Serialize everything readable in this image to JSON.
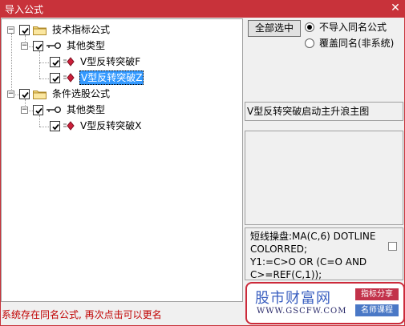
{
  "window": {
    "title": "导入公式",
    "close_glyph": "✕"
  },
  "tree": {
    "expander_open": "−",
    "nodes": [
      {
        "label": "技术指标公式"
      },
      {
        "label": "其他类型"
      },
      {
        "label": "V型反转突破F"
      },
      {
        "label": "V型反转突破Z",
        "selected": true
      },
      {
        "label": "条件选股公式"
      },
      {
        "label": "其他类型"
      },
      {
        "label": "V型反转突破X"
      }
    ]
  },
  "right": {
    "select_all_label": "全部选中",
    "radios": [
      {
        "label": "不导入同名公式",
        "checked": true
      },
      {
        "label": "覆盖同名(非系统)",
        "checked": false
      }
    ],
    "description": "V型反转突破启动主升浪主图",
    "code_lines": [
      "短线操盘:MA(C,6) DOTLINE",
      "COLORRED;",
      "Y1:=C>O OR (C=O AND",
      "C>=REF(C,1));"
    ]
  },
  "watermark": {
    "site_name": "股市财富网",
    "url": "WWW.GSCFW.COM",
    "tag1": "指标分享",
    "tag2": "名师课程"
  },
  "status_text": "系统存在同名公式, 再次点击可以更名",
  "colors": {
    "titlebar": "#c8323a",
    "selection": "#3399ff",
    "status": "#c00000"
  },
  "icons": [
    "close-icon",
    "folder-icon",
    "key-icon",
    "formula-icon",
    "checkbox-checked-icon",
    "expander-minus-icon"
  ]
}
